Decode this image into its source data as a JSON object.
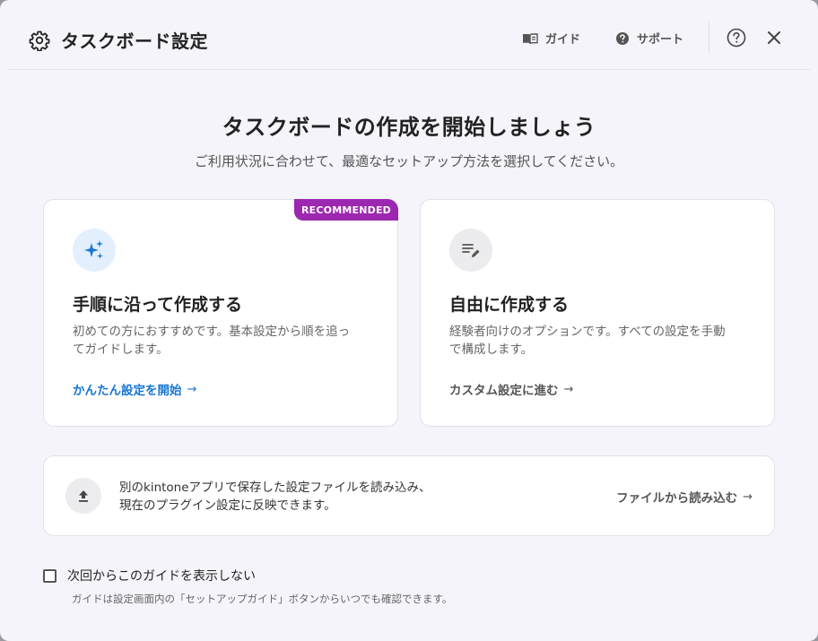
{
  "header": {
    "title": "タスクボード設定",
    "guide_label": "ガイド",
    "support_label": "サポート"
  },
  "hero": {
    "title": "タスクボードの作成を開始しましょう",
    "subtitle": "ご利用状況に合わせて、最適なセットアップ方法を選択してください。"
  },
  "cards": [
    {
      "badge": "RECOMMENDED",
      "title": "手順に沿って作成する",
      "desc_line1": "初めての方におすすめです。基本設定から順を追っ",
      "desc_line2": "てガイドします。",
      "action": "かんたん設定を開始",
      "arrow": "→"
    },
    {
      "title": "自由に作成する",
      "desc_line1": "経験者向けのオプションです。すべての設定を手動",
      "desc_line2": "で構成します。",
      "action": "カスタム設定に進む",
      "arrow": "→"
    }
  ],
  "import": {
    "line1": "別のkintoneアプリで保存した設定ファイルを読み込み、",
    "line2": "現在のプラグイン設定に反映できます。",
    "action": "ファイルから読み込む",
    "arrow": "→"
  },
  "footer": {
    "checkbox_label": "次回からこのガイドを表示しない",
    "checkbox_checked": false,
    "note": "ガイドは設定画面内の「セットアップガイド」ボタンからいつでも確認できます。"
  },
  "colors": {
    "accent_blue": "#1976d2",
    "badge_purple": "#9c27b0",
    "background": "#f4f4fa"
  }
}
